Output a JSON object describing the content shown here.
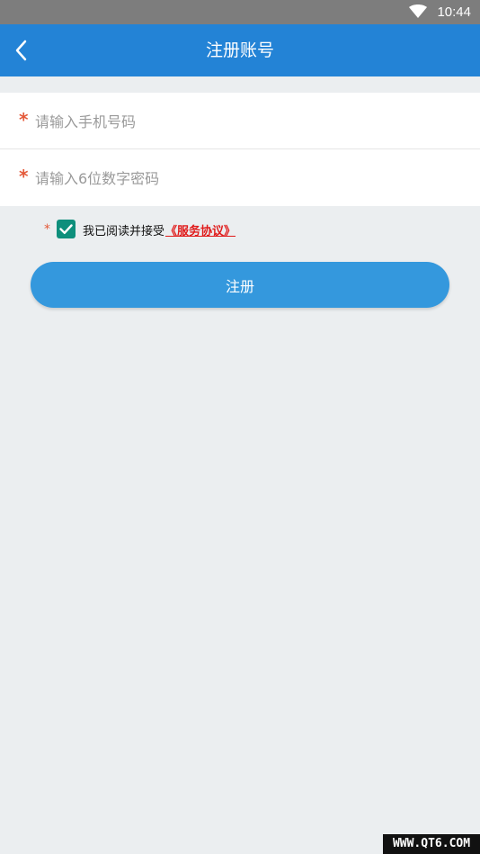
{
  "status_bar": {
    "time": "10:44",
    "icon": "wifi-icon"
  },
  "app_bar": {
    "title": "注册账号",
    "back_icon": "back-arrow-icon",
    "color": "#2383d6"
  },
  "form": {
    "phone": {
      "required_mark": "*",
      "value": "",
      "placeholder": "请输入手机号码"
    },
    "password": {
      "required_mark": "*",
      "value": "",
      "placeholder": "请输入6位数字密码"
    }
  },
  "agreement": {
    "required_mark": "*",
    "checked": true,
    "text": "我已阅读并接受",
    "link_text": "《服务协议》",
    "link_color": "#e01b1b",
    "checkbox_color": "#0e8f7c"
  },
  "register_button": {
    "label": "注册",
    "color": "#3498dd"
  },
  "watermark": "WWW.QT6.COM"
}
